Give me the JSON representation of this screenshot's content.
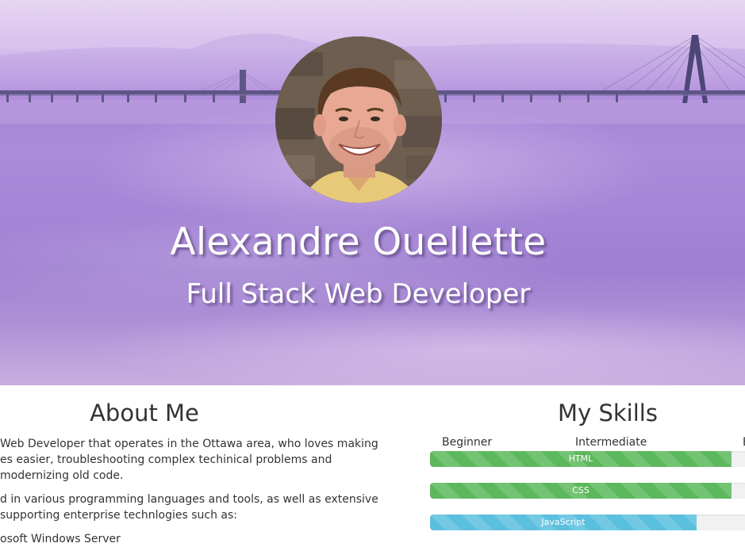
{
  "hero": {
    "name": "Alexandre Ouellette",
    "title": "Full Stack Web Developer"
  },
  "about": {
    "heading": "About Me",
    "paragraph1_line1": "Web Developer that operates in the Ottawa area, who loves making",
    "paragraph1_line2": "es easier, troubleshooting complex techinical problems and",
    "paragraph1_line3": "modernizing old code.",
    "paragraph2_line1": "d in various programming languages and tools, as well as extensive",
    "paragraph2_line2": "supporting enterprise technlogies such as:",
    "list_item1": "osoft Windows Server"
  },
  "skills": {
    "heading": "My Skills",
    "levels": [
      "Beginner",
      "Intermediate",
      "E"
    ],
    "items": [
      {
        "label": "HTML",
        "percent": 95,
        "style": "success",
        "color": "#5cb85c"
      },
      {
        "label": "CSS",
        "percent": 95,
        "style": "success",
        "color": "#5cb85c"
      },
      {
        "label": "JavaScript",
        "percent": 84,
        "style": "info",
        "color": "#5bc0de"
      }
    ]
  }
}
